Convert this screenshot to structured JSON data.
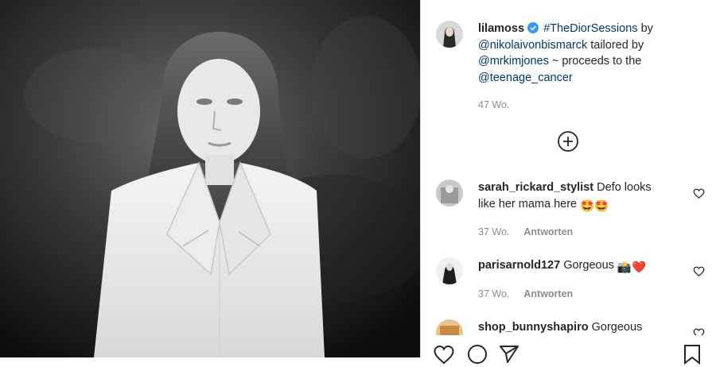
{
  "post": {
    "username": "lilamoss",
    "hashtag": "#TheDiorSessions",
    "caption_parts": [
      " by ",
      "@nikolaivonbismarck",
      " tailored by ",
      "@mrkimjones",
      " ~ proceeds to the ",
      "@teenage_cancer"
    ],
    "time": "47 Wo."
  },
  "comments": [
    {
      "username": "sarah_rickard_stylist",
      "text": "Defo looks like her mama here",
      "emojis": "🤩🤩",
      "time": "37 Wo.",
      "reply": "Antworten"
    },
    {
      "username": "parisarnold127",
      "text": "Gorgeous",
      "emojis": "📸❤️",
      "time": "37 Wo.",
      "reply": "Antworten"
    },
    {
      "username": "shop_bunnyshapiro",
      "text": "Gorgeous",
      "emojis": "",
      "time": "",
      "reply": ""
    }
  ],
  "colors": {
    "link": "#00376b",
    "verified": "#3897f0",
    "muted": "#8e8e8e",
    "heart_red": "#ed4956"
  },
  "icons": [
    "verified-badge-icon",
    "load-more-plus-icon",
    "heart-icon",
    "comment-icon",
    "share-icon",
    "bookmark-icon"
  ]
}
